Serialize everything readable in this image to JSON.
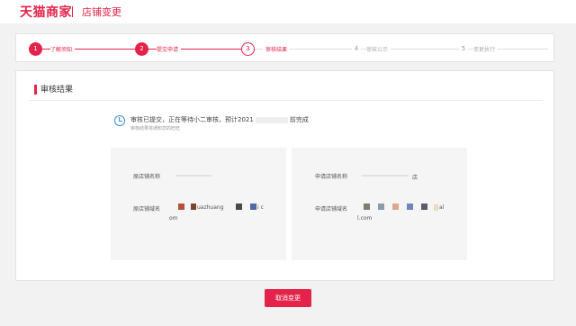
{
  "header": {
    "brand": "天猫商家",
    "subtitle": "店铺变更"
  },
  "steps": [
    {
      "number": "1",
      "label": "了解须知",
      "state": "done"
    },
    {
      "number": "2",
      "label": "提交申请",
      "state": "done"
    },
    {
      "number": "3",
      "label": "审核结果",
      "state": "current"
    },
    {
      "number": "4",
      "label": "审核公示",
      "state": "pending"
    },
    {
      "number": "5",
      "label": "变更执行",
      "state": "pending"
    }
  ],
  "section": {
    "title": "审核结果"
  },
  "notice": {
    "text_before": "审核已提交，正在等待小二审核，预计2021",
    "text_after": "前完成",
    "sub": "审核结果将通知您的旺旺"
  },
  "left_card": {
    "name_label": "原店铺名称",
    "domain_label": "原店铺域名",
    "domain_part": "uazhuang",
    "domain_tail": "i c",
    "domain_end": "om"
  },
  "right_card": {
    "name_label": "申请店铺名称",
    "name_tail": "店",
    "domain_label": "申请店铺域名",
    "domain_tail": "al",
    "domain_end": "l.com"
  },
  "actions": {
    "cancel_label": "取消变更"
  },
  "colors": {
    "accent": "#e4234a",
    "info": "#3a8fd6"
  }
}
